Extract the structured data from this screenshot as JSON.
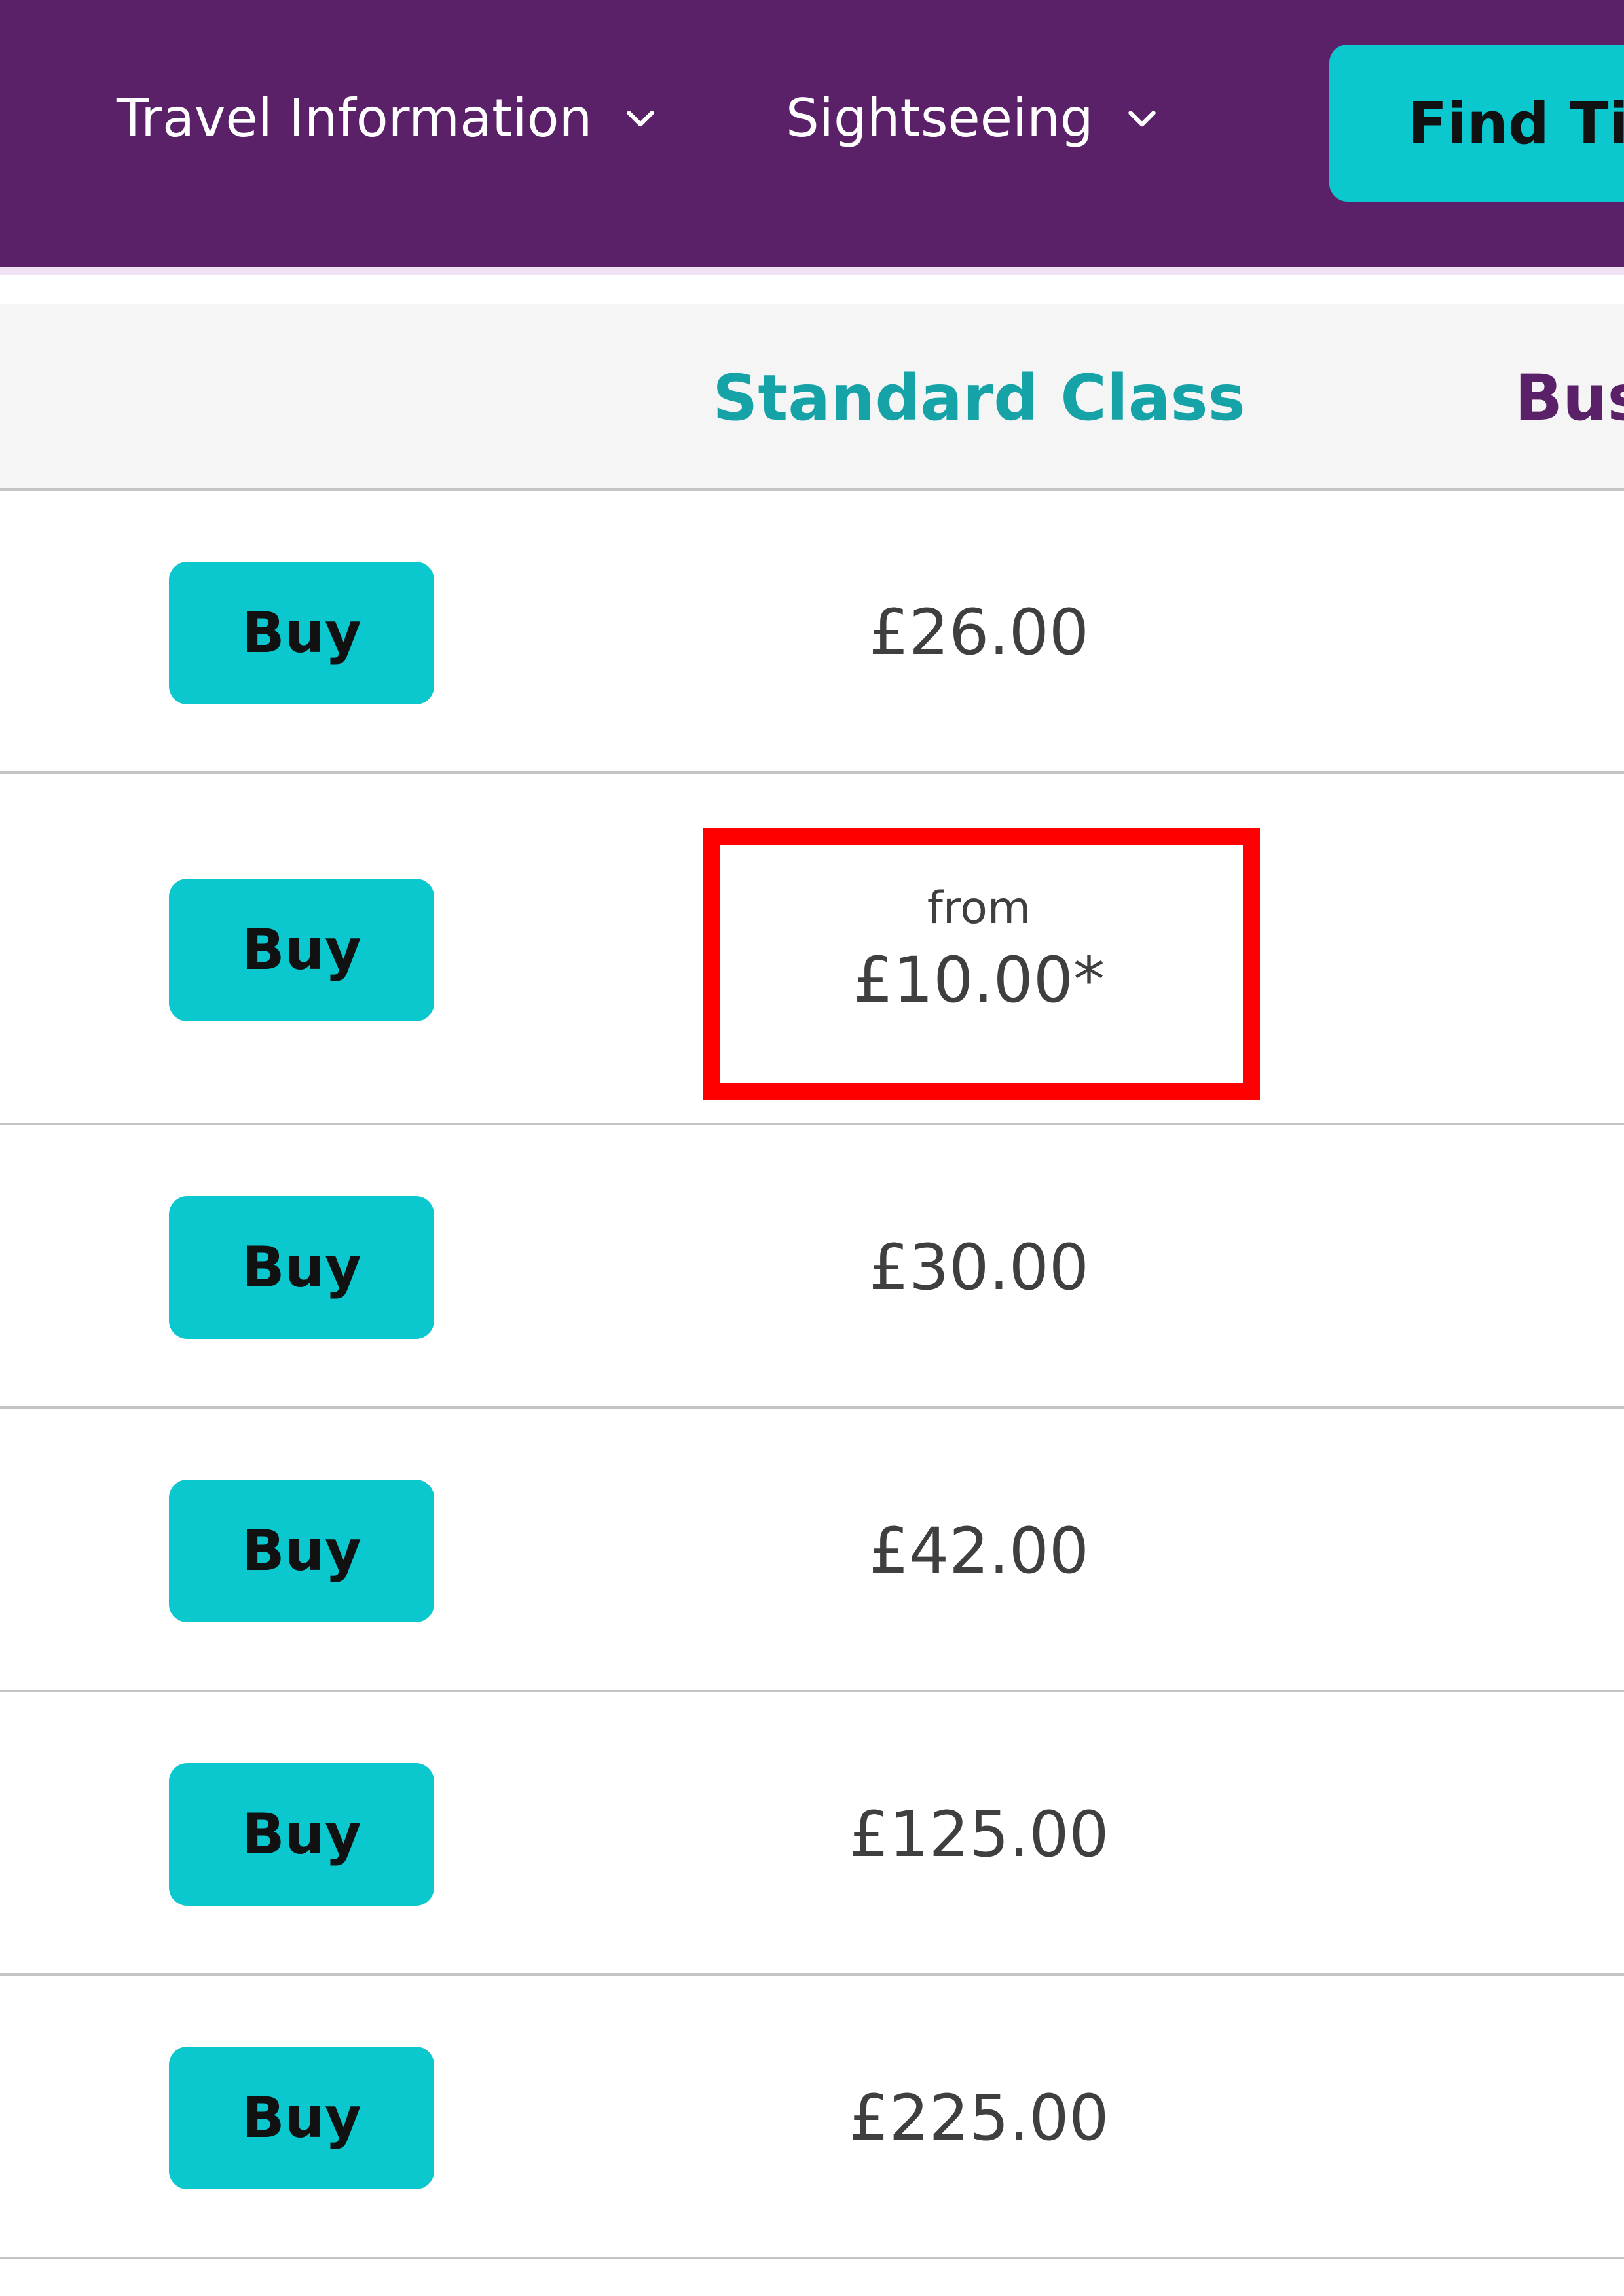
{
  "nav": {
    "items": [
      {
        "label": "Travel Information",
        "icon": "chevron-down-icon"
      },
      {
        "label": "Sightseeing",
        "icon": "chevron-down-icon"
      }
    ],
    "find_tickets_label": "Find Tic",
    "colors": {
      "background": "#5b2168",
      "accent": "#0bc8cf"
    }
  },
  "table": {
    "headers": {
      "standard": "Standard Class",
      "business": "Bus"
    },
    "rows": [
      {
        "buy_label": "Buy",
        "price": "£26.00"
      },
      {
        "buy_label": "Buy",
        "from_label": "from",
        "price": "£10.00*"
      },
      {
        "buy_label": "Buy",
        "price": "£30.00"
      },
      {
        "buy_label": "Buy",
        "price": "£42.00"
      },
      {
        "buy_label": "Buy",
        "price": "£125.00"
      },
      {
        "buy_label": "Buy",
        "price": "£225.00"
      }
    ],
    "colors": {
      "standard_header": "#15a3a8",
      "business_header": "#5b2168",
      "highlight": "#ff0000"
    }
  }
}
